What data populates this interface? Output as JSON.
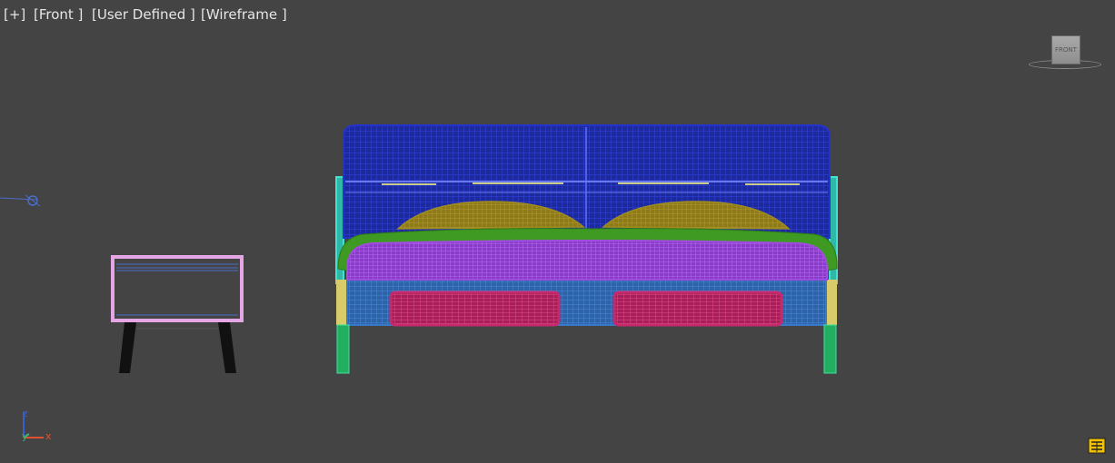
{
  "viewport": {
    "labels": {
      "plus": "[+]",
      "view": "[Front ]",
      "camera": "[User Defined ]",
      "shading": "[Wireframe ]"
    },
    "background_color": "#444444"
  },
  "viewcube": {
    "face_label": "FRONT"
  },
  "axis_tripod": {
    "z": "z",
    "y": "y",
    "x": "x",
    "colors": {
      "z": "#3a5fcd",
      "y": "#3cb371",
      "x": "#e05030"
    }
  },
  "scene_colors": {
    "headboard": "#2433cc",
    "frame_posts": "#44e0d0",
    "pillows": "#a08c1e",
    "blanket_roll": "#3e9a22",
    "mattress": "#a04ce0",
    "base": "#3a78c8",
    "drawers": "#c42a6c",
    "side_blocks": "#d8cc6a",
    "legs": "#22b060",
    "nightstand_frame": "#e4a6e4",
    "nightstand_legs": "#111111"
  },
  "icons": {
    "viewcube": "viewcube-icon",
    "axis": "axis-tripod-icon",
    "grid": "grid-panel-icon",
    "light": "light-object-icon"
  }
}
